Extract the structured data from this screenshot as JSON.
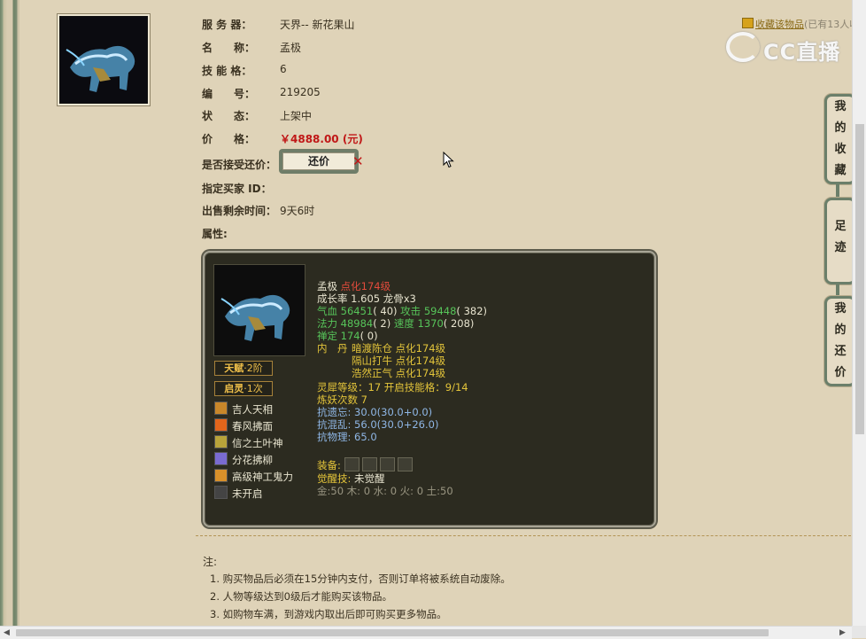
{
  "item": {
    "server_label": "服 务 器：",
    "server": "天界-- 新花果山",
    "name_label": "名　　称：",
    "name": "孟极",
    "slots_label": "技 能 格：",
    "slots": "6",
    "id_label": "编　　号：",
    "id": "219205",
    "status_label": "状　　态：",
    "status": "上架中",
    "price_label": "价　　格：",
    "price": "￥4888.00 (元)",
    "bargain_label": "是否接受还价：",
    "bargain_button": "还价",
    "buyer_label": "指定买家 ID：",
    "remain_label": "出售剩余时间：",
    "remain": "9天6时",
    "attr_label": "属性:"
  },
  "favorite": {
    "link": "收藏该物品",
    "count": "(已有13人收"
  },
  "watermark": "CC直播",
  "side_tabs": [
    {
      "label": "我的收藏",
      "chars": [
        "我",
        "的",
        "收",
        "藏"
      ]
    },
    {
      "label": "足迹",
      "chars": [
        "足",
        "迹"
      ]
    },
    {
      "label": "我的还价",
      "chars": [
        "我",
        "的",
        "还",
        "价"
      ]
    }
  ],
  "panel": {
    "badges": [
      {
        "prefix": "天赋",
        "suffix": "·2阶"
      },
      {
        "prefix": "启灵",
        "suffix": "·1次"
      }
    ],
    "skills": [
      {
        "name": "吉人天相",
        "color": "#c9872a"
      },
      {
        "name": "春风拂面",
        "color": "#e2651b"
      },
      {
        "name": "信之土叶神",
        "color": "#b8a33a"
      },
      {
        "name": "分花拂柳",
        "color": "#7a6bd1"
      },
      {
        "name": "高级神工鬼力",
        "color": "#d8902a"
      },
      {
        "name": "未开启",
        "color": "#444444"
      }
    ],
    "title_name": "孟极",
    "title_level": "点化174级",
    "growth": "成长率 1.605 龙骨x3",
    "hp_label": "气血",
    "hp": "56451",
    "hp_add": "( 40)",
    "atk_label": "攻击",
    "atk": "59448",
    "atk_add": "( 382)",
    "mp_label": "法力",
    "mp": "48984",
    "mp_add": "( 2)",
    "spd_label": "速度",
    "spd": "1370",
    "spd_add": "( 208)",
    "calm_label": "禅定",
    "calm": "174",
    "calm_add": "( 0)",
    "dan_label": "内　丹",
    "dan": [
      "暗渡陈仓 点化174级",
      "隔山打牛 点化174级",
      "浩然正气 点化174级"
    ],
    "lingxi": "灵犀等级：17 开启技能格：9/14",
    "lianyao": "炼妖次数 7",
    "kangyi_label": "抗遗忘:",
    "kangyi": "30.0(30.0+0.0)",
    "kanghun_label": "抗混乱:",
    "kanghun": "56.0(30.0+26.0)",
    "kangwuli_label": "抗物理:",
    "kangwuli": "65.0",
    "equip_label": "装备:",
    "awaken_label": "觉醒技:",
    "awaken": "未觉醒",
    "elements": "金:50 木: 0 水: 0 火: 0 土:50"
  },
  "notes": {
    "title": "注:",
    "items": [
      "1. 购买物品后必须在15分钟内支付，否则订单将被系统自动废除。",
      "2. 人物等级达到0级后才能购买该物品。",
      "3. 如购物车满，到游戏内取出后即可购买更多物品。"
    ]
  }
}
